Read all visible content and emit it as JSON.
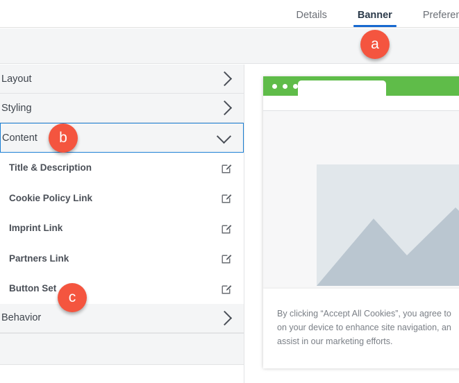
{
  "tabs": [
    {
      "label": "Details",
      "active": false
    },
    {
      "label": "Banner",
      "active": true
    },
    {
      "label": "Preferences",
      "active": false
    }
  ],
  "sidebar": {
    "sections": [
      {
        "label": "Layout",
        "state": "collapsed",
        "icon": "chevron-right-icon"
      },
      {
        "label": "Styling",
        "state": "collapsed",
        "icon": "chevron-right-icon"
      },
      {
        "label": "Content",
        "state": "expanded",
        "icon": "chevron-down-icon",
        "selected": true
      },
      {
        "label": "Behavior",
        "state": "collapsed",
        "icon": "chevron-right-icon"
      }
    ],
    "content_items": [
      {
        "label": "Title & Description",
        "action_icon": "edit-pencil-square-icon"
      },
      {
        "label": "Cookie Policy Link",
        "action_icon": "edit-pencil-square-icon"
      },
      {
        "label": "Imprint Link",
        "action_icon": "edit-pencil-square-icon"
      },
      {
        "label": "Partners Link",
        "action_icon": "edit-pencil-square-icon"
      },
      {
        "label": "Button Set",
        "action_icon": "edit-pencil-square-icon"
      }
    ]
  },
  "preview": {
    "browser": {
      "chrome_color": "#5fbc49",
      "window_dots": 3,
      "image_placeholder_icon": "image-placeholder-icon"
    },
    "banner": {
      "text": "By clicking “Accept All Cookies”, you agree to\non your device to enhance site navigation, an\nassist in our marketing efforts."
    }
  },
  "annotations": [
    {
      "id": "a",
      "label": "a",
      "color": "#f4553f"
    },
    {
      "id": "b",
      "label": "b",
      "color": "#f4553f"
    },
    {
      "id": "c",
      "label": "c",
      "color": "#f4553f"
    }
  ],
  "colors": {
    "accent_blue": "#1769d0",
    "badge_red": "#f4553f",
    "browser_green": "#5fbc49",
    "panel_gray": "#f4f5f6"
  }
}
